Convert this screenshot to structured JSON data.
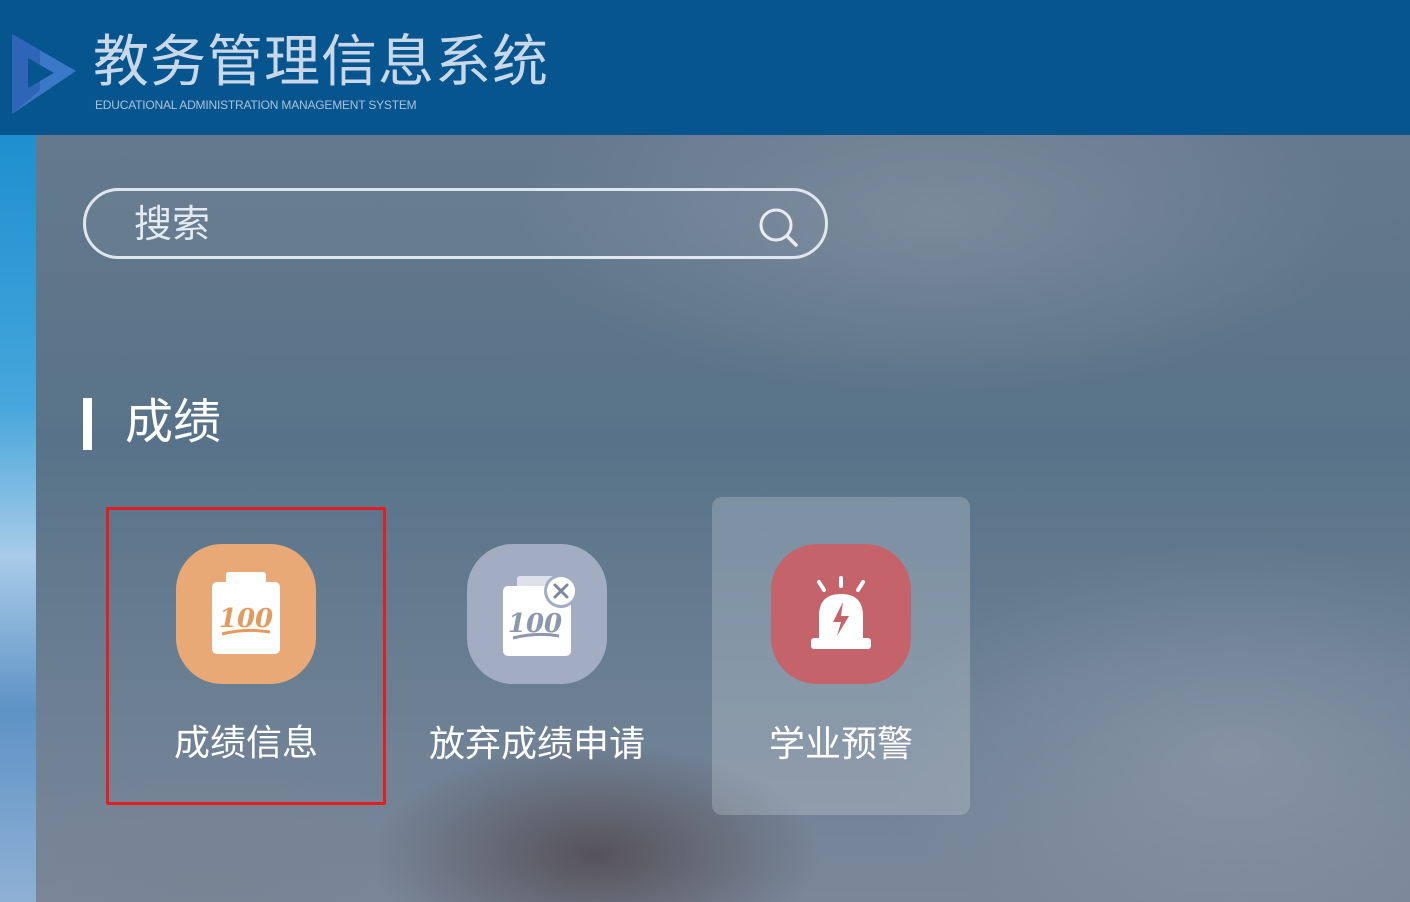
{
  "header": {
    "title": "教务管理信息系统",
    "subtitle": "EDUCATIONAL ADMINISTRATION MANAGEMENT SYSTEM",
    "logo_icon": "play-logo-icon"
  },
  "search": {
    "placeholder": "搜索",
    "icon": "search-icon"
  },
  "section": {
    "title": "成绩"
  },
  "tiles": [
    {
      "label": "成绩信息",
      "icon": "score-clipboard-icon",
      "icon_color": "#e8a977",
      "icon_text": "100",
      "state": "selected"
    },
    {
      "label": "放弃成绩申请",
      "icon": "score-clipboard-cancel-icon",
      "icon_color": "#a3adc2",
      "icon_text": "100",
      "state": "normal"
    },
    {
      "label": "学业预警",
      "icon": "alarm-siren-icon",
      "icon_color": "#c5636a",
      "state": "hovered"
    }
  ],
  "colors": {
    "header_bg": "#07558f",
    "selection_border": "#e02020"
  }
}
